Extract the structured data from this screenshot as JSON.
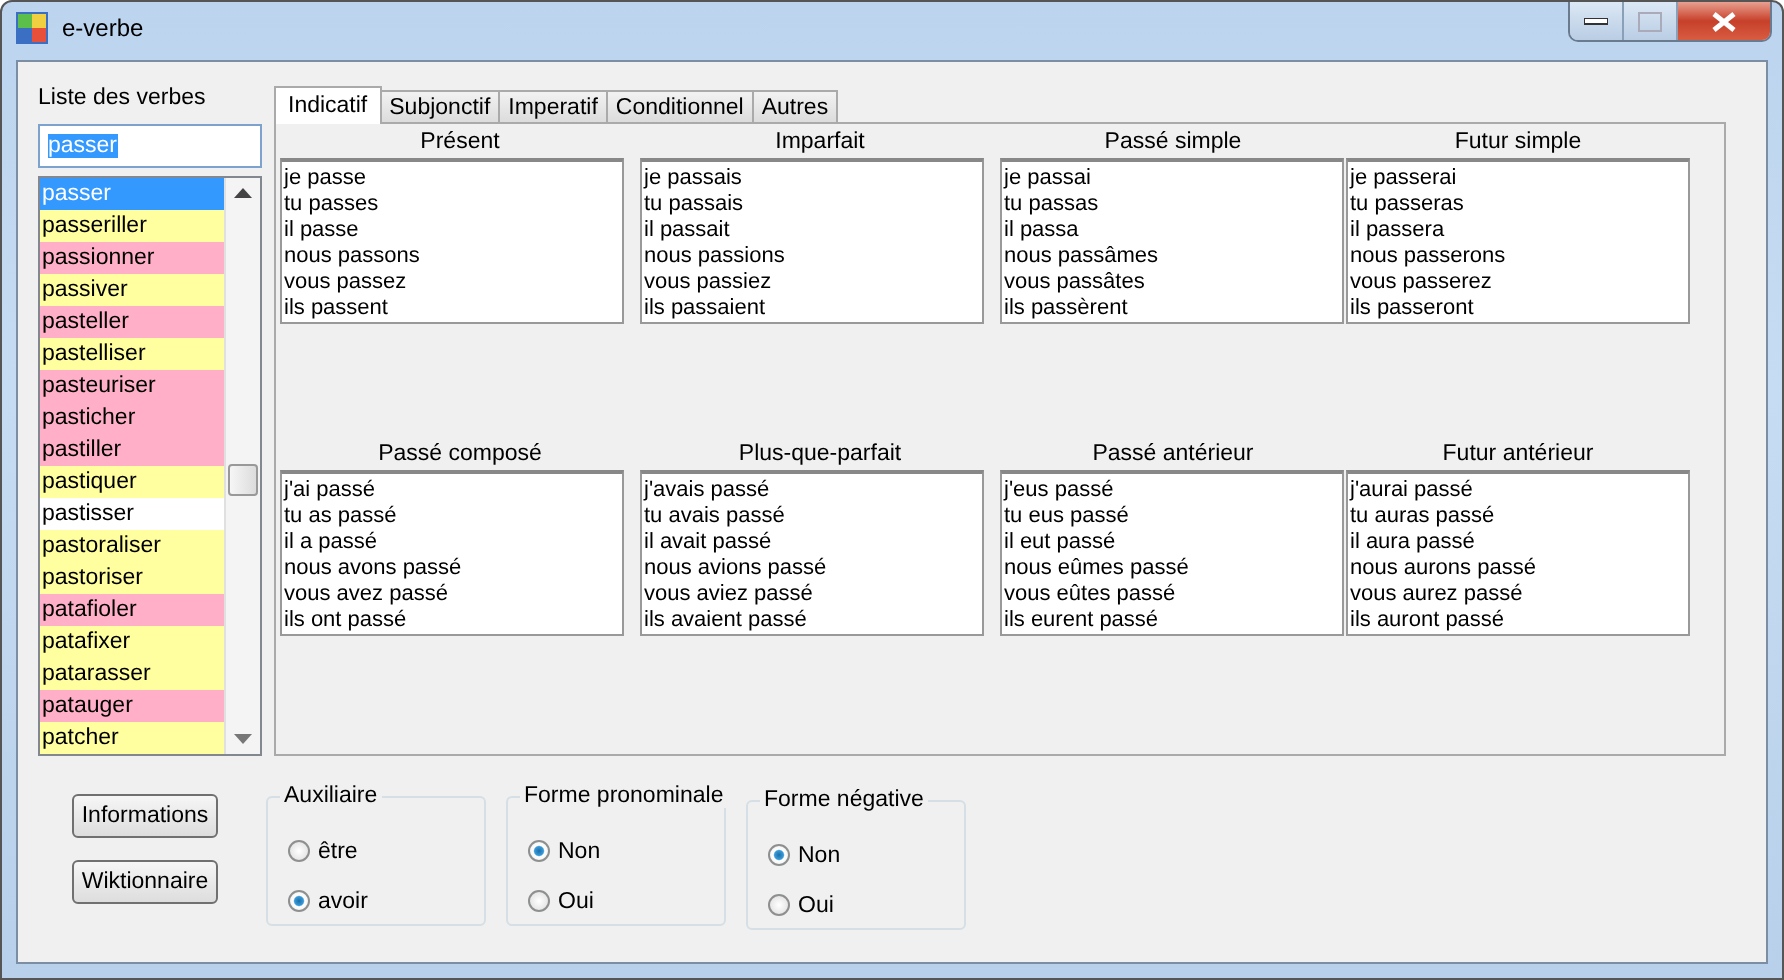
{
  "window": {
    "title": "e-verbe"
  },
  "verb_list": {
    "label": "Liste des verbes",
    "search": {
      "value": "passer"
    },
    "items": [
      {
        "label": "passer",
        "selected": true
      },
      {
        "label": "passeriller",
        "selected": false,
        "color": "#ffffa0"
      },
      {
        "label": "passionner",
        "selected": false,
        "color": "#ffb0c8"
      },
      {
        "label": "passiver",
        "selected": false,
        "color": "#ffffa0"
      },
      {
        "label": "pasteller",
        "selected": false,
        "color": "#ffb0c8"
      },
      {
        "label": "pastelliser",
        "selected": false,
        "color": "#ffffa0"
      },
      {
        "label": "pasteuriser",
        "selected": false,
        "color": "#ffb0c8"
      },
      {
        "label": "pasticher",
        "selected": false,
        "color": "#ffb0c8"
      },
      {
        "label": "pastiller",
        "selected": false,
        "color": "#ffb0c8"
      },
      {
        "label": "pastiquer",
        "selected": false,
        "color": "#ffffa0"
      },
      {
        "label": "pastisser",
        "selected": false,
        "color": "#ffffff"
      },
      {
        "label": "pastoraliser",
        "selected": false,
        "color": "#ffffa0"
      },
      {
        "label": "pastoriser",
        "selected": false,
        "color": "#ffffa0"
      },
      {
        "label": "patafioler",
        "selected": false,
        "color": "#ffb0c8"
      },
      {
        "label": "patafixer",
        "selected": false,
        "color": "#ffffa0"
      },
      {
        "label": "patarasser",
        "selected": false,
        "color": "#ffffa0"
      },
      {
        "label": "patauger",
        "selected": false,
        "color": "#ffb0c8"
      },
      {
        "label": "patcher",
        "selected": false,
        "color": "#ffffa0"
      }
    ]
  },
  "tabs": [
    {
      "label": "Indicatif",
      "selected": true
    },
    {
      "label": "Subjonctif",
      "selected": false
    },
    {
      "label": "Imperatif",
      "selected": false
    },
    {
      "label": "Conditionnel",
      "selected": false
    },
    {
      "label": "Autres",
      "selected": false
    }
  ],
  "tenses": [
    {
      "title": "Présent",
      "forms": [
        "je passe",
        "tu passes",
        "il passe",
        "nous passons",
        "vous passez",
        "ils passent"
      ]
    },
    {
      "title": "Imparfait",
      "forms": [
        "je passais",
        "tu passais",
        "il passait",
        "nous passions",
        "vous passiez",
        "ils passaient"
      ]
    },
    {
      "title": "Passé simple",
      "forms": [
        "je passai",
        "tu passas",
        "il passa",
        "nous passâmes",
        "vous passâtes",
        "ils passèrent"
      ]
    },
    {
      "title": "Futur simple",
      "forms": [
        "je passerai",
        "tu passeras",
        "il passera",
        "nous passerons",
        "vous passerez",
        "ils passeront"
      ]
    },
    {
      "title": "Passé composé",
      "forms": [
        "j'ai passé",
        "tu as passé",
        "il a passé",
        "nous avons passé",
        "vous avez passé",
        "ils ont passé"
      ]
    },
    {
      "title": "Plus-que-parfait",
      "forms": [
        "j'avais passé",
        "tu avais passé",
        "il avait passé",
        "nous avions passé",
        "vous aviez passé",
        "ils avaient passé"
      ]
    },
    {
      "title": "Passé antérieur",
      "forms": [
        "j'eus passé",
        "tu eus passé",
        "il eut passé",
        "nous eûmes passé",
        "vous eûtes passé",
        "ils eurent passé"
      ]
    },
    {
      "title": "Futur antérieur",
      "forms": [
        "j'aurai passé",
        "tu auras passé",
        "il aura passé",
        "nous aurons passé",
        "vous aurez passé",
        "ils auront passé"
      ]
    }
  ],
  "buttons": [
    "Informations",
    "Wiktionnaire"
  ],
  "groups": [
    {
      "title": "Auxiliaire",
      "options": [
        {
          "label": "être",
          "selected": false
        },
        {
          "label": "avoir",
          "selected": true
        }
      ]
    },
    {
      "title": "Forme pronominale",
      "options": [
        {
          "label": "Non",
          "selected": true
        },
        {
          "label": "Oui",
          "selected": false
        }
      ]
    },
    {
      "title": "Forme négative",
      "options": [
        {
          "label": "Non",
          "selected": true
        },
        {
          "label": "Oui",
          "selected": false
        }
      ]
    }
  ]
}
